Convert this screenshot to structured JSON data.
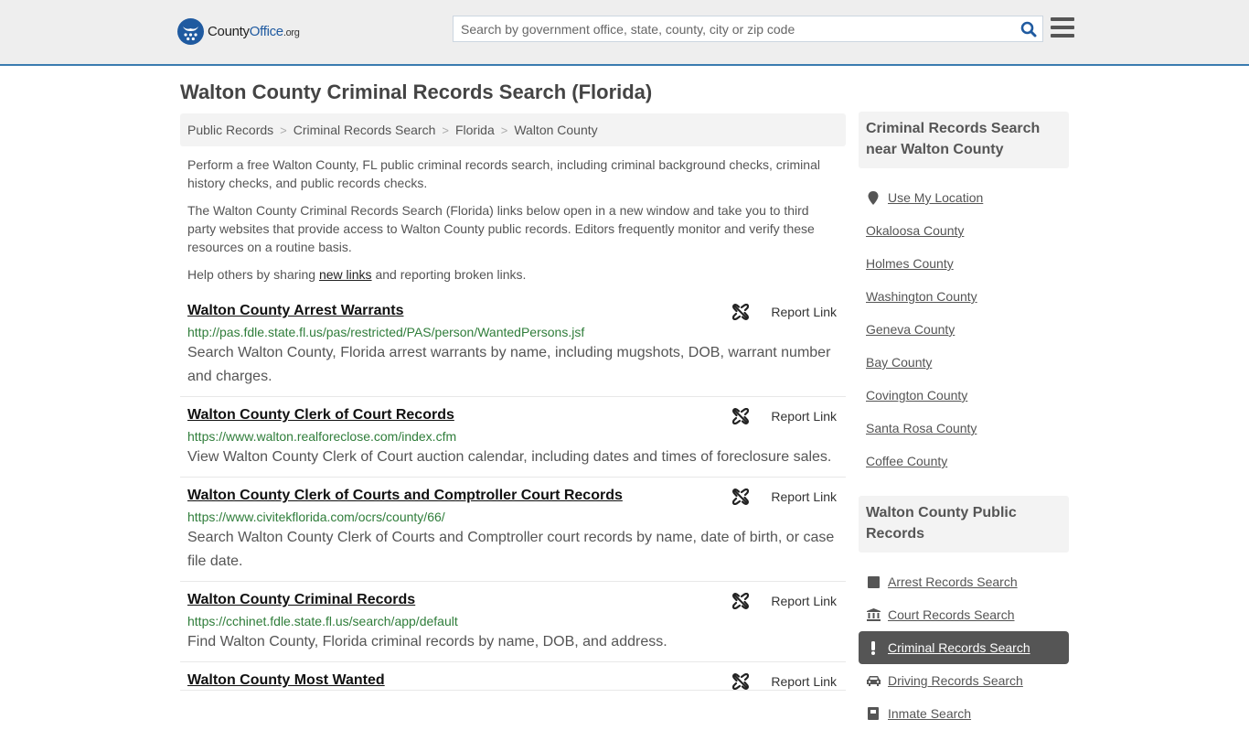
{
  "header": {
    "logo": {
      "county": "County",
      "office": "Office",
      "org": ".org"
    },
    "search": {
      "placeholder": "Search by government office, state, county, city or zip code",
      "value": ""
    },
    "colors": {
      "brand": "#1f5aa0",
      "accent_border": "#3a7bb0"
    }
  },
  "page": {
    "title": "Walton County Criminal Records Search (Florida)",
    "breadcrumb": [
      "Public Records",
      "Criminal Records Search",
      "Florida",
      "Walton County"
    ],
    "intro": {
      "p1": "Perform a free Walton County, FL public criminal records search, including criminal background checks, criminal history checks, and public records checks.",
      "p2": "The Walton County Criminal Records Search (Florida) links below open in a new window and take you to third party websites that provide access to Walton County public records. Editors frequently monitor and verify these resources on a routine basis.",
      "p3_before": "Help others by sharing ",
      "p3_link": "new links",
      "p3_after": " and reporting broken links."
    }
  },
  "results": [
    {
      "title": "Walton County Arrest Warrants",
      "url": "http://pas.fdle.state.fl.us/pas/restricted/PAS/person/WantedPersons.jsf",
      "description": "Search Walton County, Florida arrest warrants by name, including mugshots, DOB, warrant number and charges.",
      "report_label": "Report Link"
    },
    {
      "title": "Walton County Clerk of Court Records",
      "url": "https://www.walton.realforeclose.com/index.cfm",
      "description": "View Walton County Clerk of Court auction calendar, including dates and times of foreclosure sales.",
      "report_label": "Report Link"
    },
    {
      "title": "Walton County Clerk of Courts and Comptroller Court Records",
      "url": "https://www.civitekflorida.com/ocrs/county/66/",
      "description": "Search Walton County Clerk of Courts and Comptroller court records by name, date of birth, or case file date.",
      "report_label": "Report Link"
    },
    {
      "title": "Walton County Criminal Records",
      "url": "https://cchinet.fdle.state.fl.us/search/app/default",
      "description": "Find Walton County, Florida criminal records by name, DOB, and address.",
      "report_label": "Report Link"
    },
    {
      "title": "Walton County Most Wanted",
      "url": "",
      "description": "",
      "report_label": "Report Link"
    }
  ],
  "sidebar": {
    "nearby": {
      "heading": "Criminal Records Search near Walton County",
      "use_location": {
        "label": "Use My Location",
        "icon": "map-marker-icon"
      },
      "items": [
        "Okaloosa County",
        "Holmes County",
        "Washington County",
        "Geneva County",
        "Bay County",
        "Covington County",
        "Santa Rosa County",
        "Coffee County"
      ]
    },
    "public_records": {
      "heading": "Walton County Public Records",
      "items": [
        {
          "label": "Arrest Records Search",
          "icon": "square-icon",
          "active": false
        },
        {
          "label": "Court Records Search",
          "icon": "courthouse-icon",
          "active": false
        },
        {
          "label": "Criminal Records Search",
          "icon": "exclamation-icon",
          "active": true
        },
        {
          "label": "Driving Records Search",
          "icon": "car-icon",
          "active": false
        },
        {
          "label": "Inmate Search",
          "icon": "inmate-icon",
          "active": false
        }
      ]
    }
  }
}
